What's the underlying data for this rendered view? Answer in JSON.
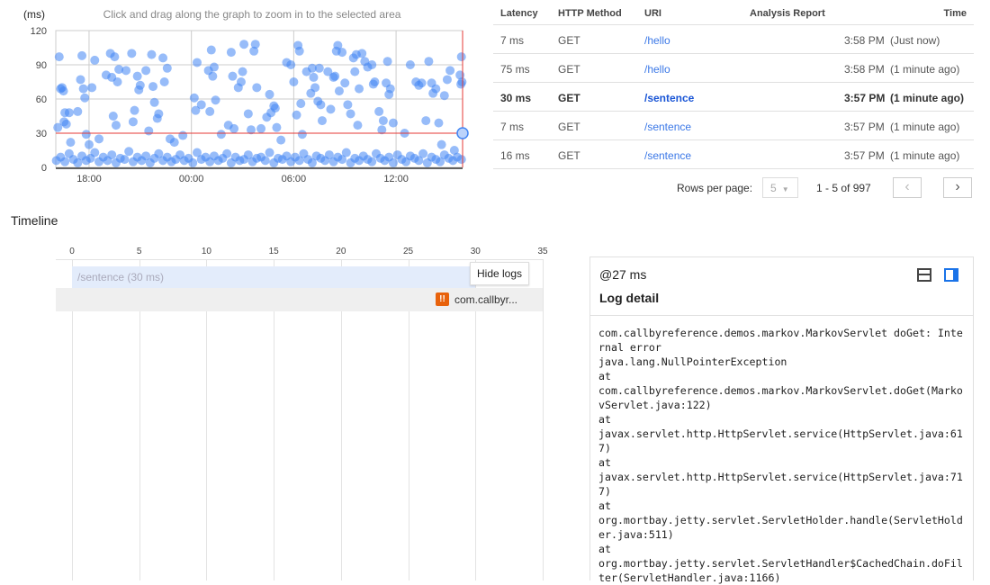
{
  "chart_data": {
    "type": "scatter",
    "ylabel": "(ms)",
    "hint": "Click and drag along the graph to zoom in to the selected area",
    "yticks": [
      0,
      30,
      60,
      90,
      120
    ],
    "ylim": [
      0,
      120
    ],
    "xticks": [
      "18:00",
      "00:00",
      "06:00",
      "12:00"
    ],
    "xlim": [
      "16:03",
      "15:54"
    ],
    "grid": true,
    "color": "#4285f4",
    "selected": {
      "x": "15:54",
      "y": 30
    },
    "points": [
      [
        "16:10",
        35
      ],
      [
        "16:15",
        97
      ],
      [
        "16:20",
        69
      ],
      [
        "16:25",
        70
      ],
      [
        "16:30",
        67
      ],
      [
        "16:35",
        48
      ],
      [
        "16:32",
        40
      ],
      [
        "16:40",
        38
      ],
      [
        "16:50",
        48
      ],
      [
        "16:55",
        22
      ],
      [
        "17:20",
        49
      ],
      [
        "17:30",
        77
      ],
      [
        "17:35",
        98
      ],
      [
        "17:40",
        69
      ],
      [
        "17:45",
        61
      ],
      [
        "17:50",
        29
      ],
      [
        "18:00",
        20
      ],
      [
        "18:10",
        70
      ],
      [
        "18:20",
        94
      ],
      [
        "18:35",
        25
      ],
      [
        "19:00",
        81
      ],
      [
        "19:15",
        100
      ],
      [
        "19:20",
        79
      ],
      [
        "19:25",
        45
      ],
      [
        "19:30",
        97
      ],
      [
        "19:35",
        37
      ],
      [
        "19:40",
        75
      ],
      [
        "19:45",
        86
      ],
      [
        "20:10",
        85
      ],
      [
        "20:30",
        100
      ],
      [
        "20:35",
        40
      ],
      [
        "20:40",
        50
      ],
      [
        "20:50",
        80
      ],
      [
        "20:55",
        68
      ],
      [
        "21:00",
        72
      ],
      [
        "21:20",
        85
      ],
      [
        "21:30",
        32
      ],
      [
        "21:40",
        99
      ],
      [
        "21:45",
        71
      ],
      [
        "21:50",
        57
      ],
      [
        "22:00",
        43
      ],
      [
        "22:05",
        47
      ],
      [
        "22:20",
        96
      ],
      [
        "22:25",
        75
      ],
      [
        "22:35",
        87
      ],
      [
        "22:45",
        25
      ],
      [
        "23:00",
        22
      ],
      [
        "23:30",
        28
      ],
      [
        "00:10",
        61
      ],
      [
        "00:15",
        50
      ],
      [
        "00:20",
        92
      ],
      [
        "00:35",
        55
      ],
      [
        "01:00",
        85
      ],
      [
        "01:05",
        49
      ],
      [
        "01:10",
        103
      ],
      [
        "01:15",
        80
      ],
      [
        "01:20",
        88
      ],
      [
        "01:25",
        59
      ],
      [
        "01:45",
        29
      ],
      [
        "02:10",
        37
      ],
      [
        "02:20",
        101
      ],
      [
        "02:25",
        80
      ],
      [
        "02:30",
        34
      ],
      [
        "02:45",
        70
      ],
      [
        "02:55",
        75
      ],
      [
        "03:00",
        84
      ],
      [
        "03:05",
        108
      ],
      [
        "03:20",
        47
      ],
      [
        "03:30",
        33
      ],
      [
        "03:40",
        102
      ],
      [
        "03:45",
        108
      ],
      [
        "03:50",
        70
      ],
      [
        "04:05",
        34
      ],
      [
        "04:25",
        44
      ],
      [
        "04:35",
        64
      ],
      [
        "04:40",
        48
      ],
      [
        "04:50",
        54
      ],
      [
        "04:55",
        52
      ],
      [
        "05:00",
        35
      ],
      [
        "05:15",
        24
      ],
      [
        "05:35",
        92
      ],
      [
        "05:50",
        90
      ],
      [
        "06:00",
        75
      ],
      [
        "06:10",
        46
      ],
      [
        "06:15",
        107
      ],
      [
        "06:20",
        102
      ],
      [
        "06:25",
        56
      ],
      [
        "06:30",
        29
      ],
      [
        "06:45",
        84
      ],
      [
        "07:00",
        65
      ],
      [
        "07:05",
        87
      ],
      [
        "07:10",
        79
      ],
      [
        "07:15",
        70
      ],
      [
        "07:25",
        58
      ],
      [
        "07:30",
        87
      ],
      [
        "07:35",
        55
      ],
      [
        "07:40",
        41
      ],
      [
        "08:00",
        84
      ],
      [
        "08:10",
        51
      ],
      [
        "08:20",
        79
      ],
      [
        "08:25",
        80
      ],
      [
        "08:30",
        102
      ],
      [
        "08:35",
        107
      ],
      [
        "08:40",
        67
      ],
      [
        "08:50",
        101
      ],
      [
        "09:00",
        74
      ],
      [
        "09:10",
        55
      ],
      [
        "09:20",
        47
      ],
      [
        "09:30",
        96
      ],
      [
        "09:35",
        84
      ],
      [
        "09:40",
        99
      ],
      [
        "09:45",
        37
      ],
      [
        "09:50",
        69
      ],
      [
        "10:00",
        100
      ],
      [
        "10:10",
        93
      ],
      [
        "10:20",
        88
      ],
      [
        "10:35",
        90
      ],
      [
        "10:40",
        73
      ],
      [
        "10:45",
        75
      ],
      [
        "11:00",
        49
      ],
      [
        "11:10",
        33
      ],
      [
        "11:15",
        41
      ],
      [
        "11:25",
        74
      ],
      [
        "11:30",
        93
      ],
      [
        "11:35",
        64
      ],
      [
        "11:40",
        69
      ],
      [
        "11:50",
        39
      ],
      [
        "12:30",
        30
      ],
      [
        "12:50",
        90
      ],
      [
        "13:10",
        75
      ],
      [
        "13:20",
        72
      ],
      [
        "13:30",
        74
      ],
      [
        "13:45",
        41
      ],
      [
        "13:55",
        93
      ],
      [
        "14:05",
        74
      ],
      [
        "14:10",
        65
      ],
      [
        "14:20",
        69
      ],
      [
        "14:30",
        39
      ],
      [
        "14:40",
        20
      ],
      [
        "14:50",
        63
      ],
      [
        "15:00",
        77
      ],
      [
        "15:10",
        85
      ],
      [
        "15:25",
        15
      ],
      [
        "15:45",
        81
      ],
      [
        "15:48",
        73
      ],
      [
        "15:50",
        97
      ],
      [
        "15:52",
        75
      ],
      [
        "16:05",
        6
      ],
      [
        "16:20",
        9
      ],
      [
        "16:35",
        5
      ],
      [
        "16:50",
        12
      ],
      [
        "17:05",
        7
      ],
      [
        "17:20",
        4
      ],
      [
        "17:35",
        10
      ],
      [
        "17:50",
        6
      ],
      [
        "18:05",
        8
      ],
      [
        "18:20",
        13
      ],
      [
        "18:35",
        5
      ],
      [
        "18:50",
        9
      ],
      [
        "19:05",
        6
      ],
      [
        "19:20",
        11
      ],
      [
        "19:35",
        4
      ],
      [
        "19:50",
        8
      ],
      [
        "20:05",
        7
      ],
      [
        "20:20",
        14
      ],
      [
        "20:35",
        5
      ],
      [
        "20:50",
        9
      ],
      [
        "21:05",
        6
      ],
      [
        "21:20",
        10
      ],
      [
        "21:35",
        4
      ],
      [
        "21:50",
        8
      ],
      [
        "22:05",
        12
      ],
      [
        "22:20",
        6
      ],
      [
        "22:35",
        9
      ],
      [
        "22:50",
        5
      ],
      [
        "23:05",
        7
      ],
      [
        "23:20",
        11
      ],
      [
        "23:35",
        6
      ],
      [
        "23:50",
        8
      ],
      [
        "00:05",
        4
      ],
      [
        "00:20",
        13
      ],
      [
        "00:35",
        7
      ],
      [
        "00:50",
        9
      ],
      [
        "01:05",
        5
      ],
      [
        "01:20",
        10
      ],
      [
        "01:35",
        6
      ],
      [
        "01:50",
        8
      ],
      [
        "02:05",
        12
      ],
      [
        "02:20",
        4
      ],
      [
        "02:35",
        9
      ],
      [
        "02:50",
        6
      ],
      [
        "03:05",
        7
      ],
      [
        "03:20",
        11
      ],
      [
        "03:35",
        5
      ],
      [
        "03:50",
        8
      ],
      [
        "04:05",
        9
      ],
      [
        "04:20",
        6
      ],
      [
        "04:35",
        13
      ],
      [
        "04:50",
        4
      ],
      [
        "05:05",
        8
      ],
      [
        "05:20",
        7
      ],
      [
        "05:35",
        10
      ],
      [
        "05:50",
        5
      ],
      [
        "06:05",
        9
      ],
      [
        "06:20",
        6
      ],
      [
        "06:35",
        12
      ],
      [
        "06:50",
        7
      ],
      [
        "07:05",
        4
      ],
      [
        "07:20",
        10
      ],
      [
        "07:35",
        8
      ],
      [
        "07:50",
        6
      ],
      [
        "08:05",
        11
      ],
      [
        "08:20",
        5
      ],
      [
        "08:35",
        9
      ],
      [
        "08:50",
        7
      ],
      [
        "09:05",
        13
      ],
      [
        "09:20",
        4
      ],
      [
        "09:35",
        8
      ],
      [
        "09:50",
        6
      ],
      [
        "10:05",
        10
      ],
      [
        "10:20",
        7
      ],
      [
        "10:35",
        5
      ],
      [
        "10:50",
        12
      ],
      [
        "11:05",
        8
      ],
      [
        "11:20",
        6
      ],
      [
        "11:35",
        9
      ],
      [
        "11:50",
        4
      ],
      [
        "12:05",
        11
      ],
      [
        "12:20",
        7
      ],
      [
        "12:35",
        5
      ],
      [
        "12:50",
        10
      ],
      [
        "13:05",
        8
      ],
      [
        "13:20",
        6
      ],
      [
        "13:35",
        12
      ],
      [
        "13:50",
        4
      ],
      [
        "14:05",
        9
      ],
      [
        "14:20",
        7
      ],
      [
        "14:35",
        5
      ],
      [
        "14:50",
        11
      ],
      [
        "15:05",
        8
      ],
      [
        "15:20",
        6
      ],
      [
        "15:35",
        9
      ],
      [
        "15:50",
        7
      ]
    ]
  },
  "table": {
    "headers": [
      "Latency",
      "HTTP Method",
      "URI",
      "Analysis Report",
      "Time"
    ],
    "rows": [
      {
        "latency": "7 ms",
        "method": "GET",
        "uri": "/hello",
        "time": "3:58 PM",
        "ago": "(Just now)"
      },
      {
        "latency": "75 ms",
        "method": "GET",
        "uri": "/hello",
        "time": "3:58 PM",
        "ago": "(1 minute ago)"
      },
      {
        "latency": "30 ms",
        "method": "GET",
        "uri": "/sentence",
        "time": "3:57 PM",
        "ago": "(1 minute ago)",
        "selected": true
      },
      {
        "latency": "7 ms",
        "method": "GET",
        "uri": "/sentence",
        "time": "3:57 PM",
        "ago": "(1 minute ago)"
      },
      {
        "latency": "16 ms",
        "method": "GET",
        "uri": "/sentence",
        "time": "3:57 PM",
        "ago": "(1 minute ago)"
      }
    ],
    "rows_per_page_label": "Rows per page:",
    "rows_per_page": "5",
    "range": "1 - 5 of 997"
  },
  "timeline": {
    "title": "Timeline",
    "ticks": [
      "0",
      "5",
      "10",
      "15",
      "20",
      "25",
      "30",
      "35"
    ],
    "span_label": "/sentence (30 ms)",
    "span_ms": 30,
    "hide_logs": "Hide logs",
    "log_badge": "!!",
    "log_label": "com.callbyr...",
    "log_at_ms": 27
  },
  "log_panel": {
    "at": "@27 ms",
    "title": "Log detail",
    "text": "com.callbyreference.demos.markov.MarkovServlet doGet: Internal error\njava.lang.NullPointerException\nat\ncom.callbyreference.demos.markov.MarkovServlet.doGet(MarkovServlet.java:122)\nat\njavax.servlet.http.HttpServlet.service(HttpServlet.java:617)\nat\njavax.servlet.http.HttpServlet.service(HttpServlet.java:717)\nat\norg.mortbay.jetty.servlet.ServletHolder.handle(ServletHolder.java:511)\nat\norg.mortbay.jetty.servlet.ServletHandler$CachedChain.doFilter(ServletHandler.java:1166)"
  }
}
